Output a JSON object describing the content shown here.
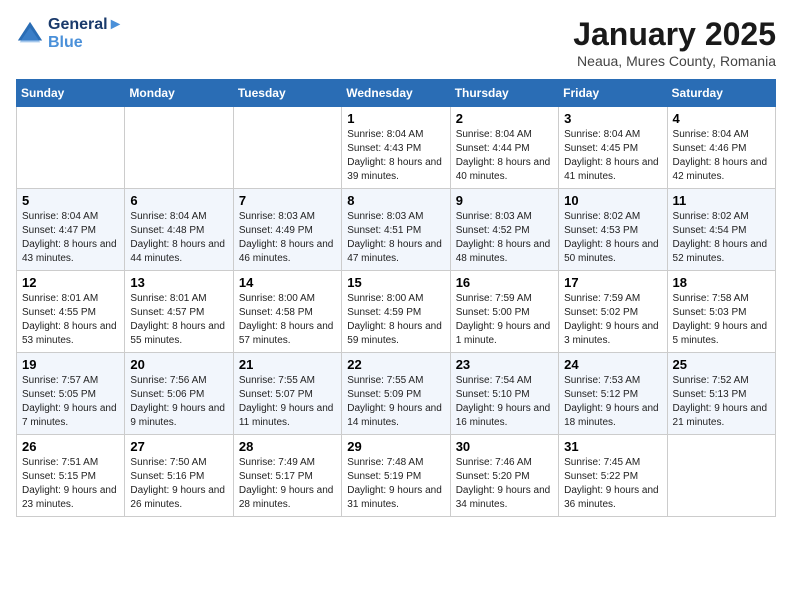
{
  "logo": {
    "line1": "General",
    "line2": "Blue"
  },
  "title": "January 2025",
  "subtitle": "Neaua, Mures County, Romania",
  "weekdays": [
    "Sunday",
    "Monday",
    "Tuesday",
    "Wednesday",
    "Thursday",
    "Friday",
    "Saturday"
  ],
  "weeks": [
    [
      {
        "day": "",
        "info": ""
      },
      {
        "day": "",
        "info": ""
      },
      {
        "day": "",
        "info": ""
      },
      {
        "day": "1",
        "info": "Sunrise: 8:04 AM\nSunset: 4:43 PM\nDaylight: 8 hours\nand 39 minutes."
      },
      {
        "day": "2",
        "info": "Sunrise: 8:04 AM\nSunset: 4:44 PM\nDaylight: 8 hours\nand 40 minutes."
      },
      {
        "day": "3",
        "info": "Sunrise: 8:04 AM\nSunset: 4:45 PM\nDaylight: 8 hours\nand 41 minutes."
      },
      {
        "day": "4",
        "info": "Sunrise: 8:04 AM\nSunset: 4:46 PM\nDaylight: 8 hours\nand 42 minutes."
      }
    ],
    [
      {
        "day": "5",
        "info": "Sunrise: 8:04 AM\nSunset: 4:47 PM\nDaylight: 8 hours\nand 43 minutes."
      },
      {
        "day": "6",
        "info": "Sunrise: 8:04 AM\nSunset: 4:48 PM\nDaylight: 8 hours\nand 44 minutes."
      },
      {
        "day": "7",
        "info": "Sunrise: 8:03 AM\nSunset: 4:49 PM\nDaylight: 8 hours\nand 46 minutes."
      },
      {
        "day": "8",
        "info": "Sunrise: 8:03 AM\nSunset: 4:51 PM\nDaylight: 8 hours\nand 47 minutes."
      },
      {
        "day": "9",
        "info": "Sunrise: 8:03 AM\nSunset: 4:52 PM\nDaylight: 8 hours\nand 48 minutes."
      },
      {
        "day": "10",
        "info": "Sunrise: 8:02 AM\nSunset: 4:53 PM\nDaylight: 8 hours\nand 50 minutes."
      },
      {
        "day": "11",
        "info": "Sunrise: 8:02 AM\nSunset: 4:54 PM\nDaylight: 8 hours\nand 52 minutes."
      }
    ],
    [
      {
        "day": "12",
        "info": "Sunrise: 8:01 AM\nSunset: 4:55 PM\nDaylight: 8 hours\nand 53 minutes."
      },
      {
        "day": "13",
        "info": "Sunrise: 8:01 AM\nSunset: 4:57 PM\nDaylight: 8 hours\nand 55 minutes."
      },
      {
        "day": "14",
        "info": "Sunrise: 8:00 AM\nSunset: 4:58 PM\nDaylight: 8 hours\nand 57 minutes."
      },
      {
        "day": "15",
        "info": "Sunrise: 8:00 AM\nSunset: 4:59 PM\nDaylight: 8 hours\nand 59 minutes."
      },
      {
        "day": "16",
        "info": "Sunrise: 7:59 AM\nSunset: 5:00 PM\nDaylight: 9 hours\nand 1 minute."
      },
      {
        "day": "17",
        "info": "Sunrise: 7:59 AM\nSunset: 5:02 PM\nDaylight: 9 hours\nand 3 minutes."
      },
      {
        "day": "18",
        "info": "Sunrise: 7:58 AM\nSunset: 5:03 PM\nDaylight: 9 hours\nand 5 minutes."
      }
    ],
    [
      {
        "day": "19",
        "info": "Sunrise: 7:57 AM\nSunset: 5:05 PM\nDaylight: 9 hours\nand 7 minutes."
      },
      {
        "day": "20",
        "info": "Sunrise: 7:56 AM\nSunset: 5:06 PM\nDaylight: 9 hours\nand 9 minutes."
      },
      {
        "day": "21",
        "info": "Sunrise: 7:55 AM\nSunset: 5:07 PM\nDaylight: 9 hours\nand 11 minutes."
      },
      {
        "day": "22",
        "info": "Sunrise: 7:55 AM\nSunset: 5:09 PM\nDaylight: 9 hours\nand 14 minutes."
      },
      {
        "day": "23",
        "info": "Sunrise: 7:54 AM\nSunset: 5:10 PM\nDaylight: 9 hours\nand 16 minutes."
      },
      {
        "day": "24",
        "info": "Sunrise: 7:53 AM\nSunset: 5:12 PM\nDaylight: 9 hours\nand 18 minutes."
      },
      {
        "day": "25",
        "info": "Sunrise: 7:52 AM\nSunset: 5:13 PM\nDaylight: 9 hours\nand 21 minutes."
      }
    ],
    [
      {
        "day": "26",
        "info": "Sunrise: 7:51 AM\nSunset: 5:15 PM\nDaylight: 9 hours\nand 23 minutes."
      },
      {
        "day": "27",
        "info": "Sunrise: 7:50 AM\nSunset: 5:16 PM\nDaylight: 9 hours\nand 26 minutes."
      },
      {
        "day": "28",
        "info": "Sunrise: 7:49 AM\nSunset: 5:17 PM\nDaylight: 9 hours\nand 28 minutes."
      },
      {
        "day": "29",
        "info": "Sunrise: 7:48 AM\nSunset: 5:19 PM\nDaylight: 9 hours\nand 31 minutes."
      },
      {
        "day": "30",
        "info": "Sunrise: 7:46 AM\nSunset: 5:20 PM\nDaylight: 9 hours\nand 34 minutes."
      },
      {
        "day": "31",
        "info": "Sunrise: 7:45 AM\nSunset: 5:22 PM\nDaylight: 9 hours\nand 36 minutes."
      },
      {
        "day": "",
        "info": ""
      }
    ]
  ]
}
